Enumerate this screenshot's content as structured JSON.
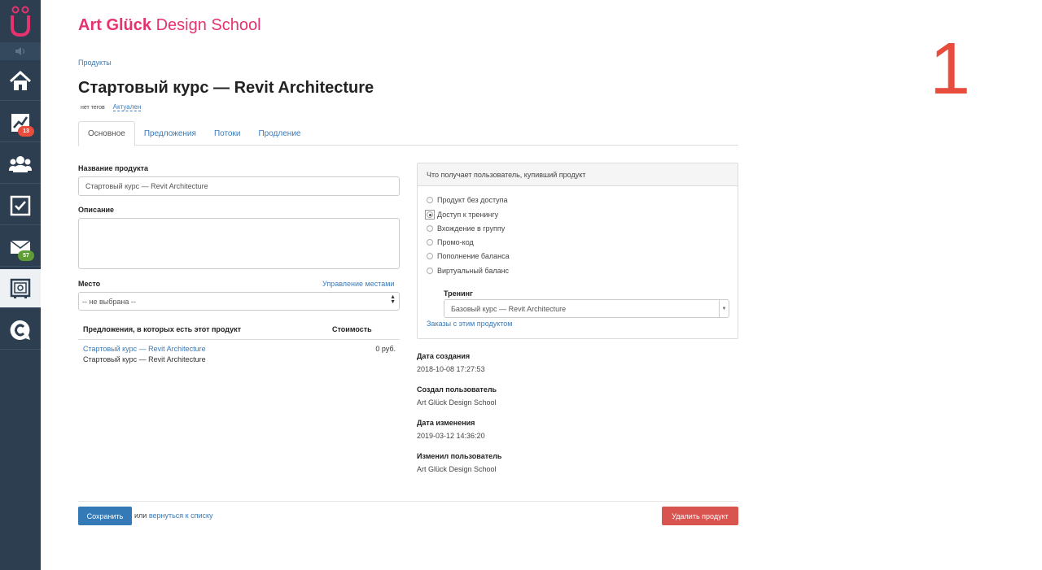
{
  "brand": {
    "name_bold": "Art Glück",
    "name_rest": "Design School",
    "color": "#e6336e"
  },
  "step_number": "1",
  "sidebar": {
    "logo_letter": "Ü",
    "items": [
      {
        "icon": "home-icon"
      },
      {
        "icon": "chart-icon",
        "badge": "13",
        "badge_color": "#e74c3c"
      },
      {
        "icon": "users-icon"
      },
      {
        "icon": "checkbox-icon"
      },
      {
        "icon": "mail-icon",
        "badge": "57",
        "badge_color": "#5f9c35"
      },
      {
        "icon": "safe-icon",
        "active": true
      },
      {
        "icon": "chat-icon"
      }
    ]
  },
  "breadcrumb": "Продукты",
  "page_title": "Стартовый курс — Revit Architecture",
  "meta": {
    "tags": "нет тегов",
    "status": "Актуален"
  },
  "tabs": [
    {
      "label": "Основное",
      "active": true
    },
    {
      "label": "Предложения"
    },
    {
      "label": "Потоки"
    },
    {
      "label": "Продление"
    }
  ],
  "form": {
    "name_label": "Название продукта",
    "name_value": "Стартовый курс — Revit Architecture",
    "description_label": "Описание",
    "description_value": "",
    "place_label": "Место",
    "place_manage_link": "Управление местами",
    "place_value": "-- не выбрана --"
  },
  "offers_table": {
    "headers": [
      "Предложения, в которых есть этот продукт",
      "Стоимость"
    ],
    "rows": [
      {
        "title": "Стартовый курс — Revit Architecture",
        "subtitle": "Стартовый курс — Revit Architecture",
        "price": "0 руб."
      }
    ]
  },
  "access_panel": {
    "title": "Что получает пользователь, купивший продукт",
    "options": [
      {
        "label": "Продукт без доступа",
        "checked": false
      },
      {
        "label": "Доступ к тренингу",
        "checked": true
      },
      {
        "label": "Вхождение в группу",
        "checked": false
      },
      {
        "label": "Промо-код",
        "checked": false
      },
      {
        "label": "Пополнение баланса",
        "checked": false
      },
      {
        "label": "Виртуальный баланс",
        "checked": false
      }
    ],
    "training_label": "Тренинг",
    "training_value": "Базовый курс — Revit Architecture",
    "orders_link": "Заказы с этим продуктом"
  },
  "info": {
    "created_label": "Дата создания",
    "created_value": "2018-10-08 17:27:53",
    "created_by_label": "Создал пользователь",
    "created_by_value": "Art Glück Design School",
    "modified_label": "Дата изменения",
    "modified_value": "2019-03-12 14:36:20",
    "modified_by_label": "Изменил пользователь",
    "modified_by_value": "Art Glück Design School"
  },
  "actions": {
    "save": "Сохранить",
    "or": "или",
    "back_link": "вернуться к списку",
    "delete": "Удалить продукт"
  }
}
